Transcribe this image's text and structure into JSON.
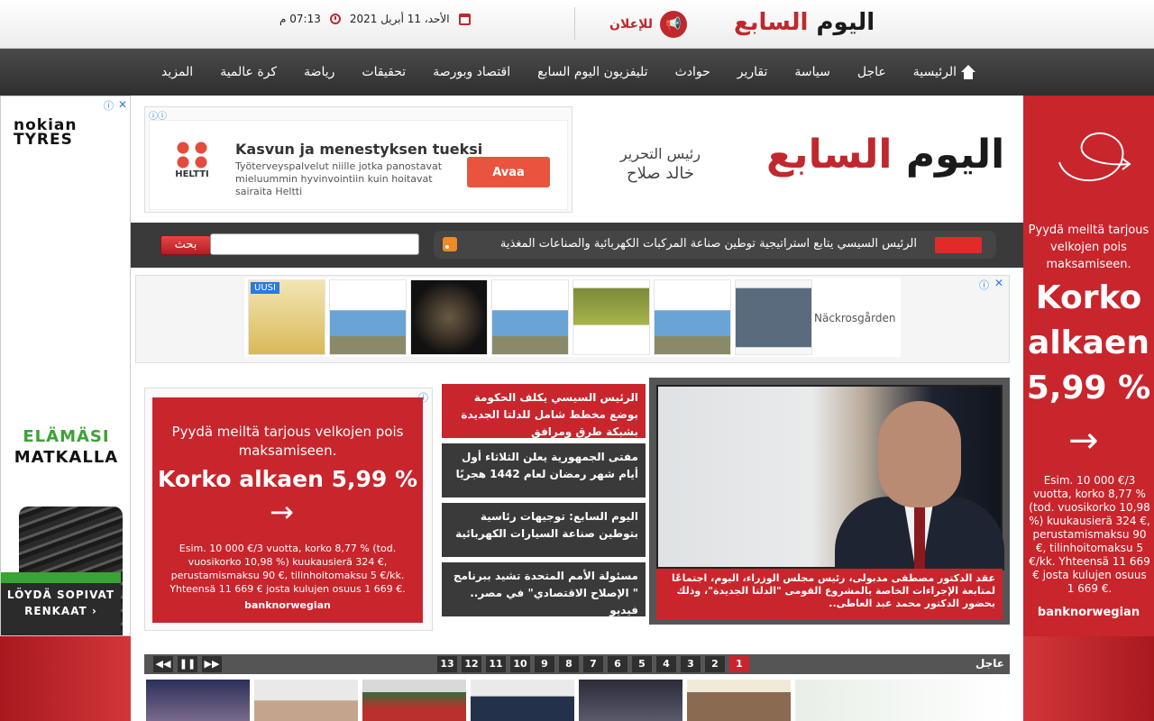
{
  "topbar": {
    "date": "الأحد، 11 أبريل 2021",
    "time": "07:13 م",
    "advertise_label": "للإعلان",
    "logo_red": "اليوم",
    "logo_dark": "السابع"
  },
  "nav": {
    "items": [
      "الرئيسية",
      "عاجل",
      "سياسة",
      "تقارير",
      "حوادث",
      "تليفزيون اليوم السابع",
      "اقتصاد وبورصة",
      "تحقيقات",
      "رياضة",
      "كرة عالمية",
      "المزيد"
    ]
  },
  "left_ad": {
    "brand": "nokian TYRES",
    "slogan_line1": "ELÄMÄSI",
    "slogan_line2": "MATKALLA",
    "cta_line1": "LÖYDÄ SOPIVAT",
    "cta_line2": "RENKAAT ›"
  },
  "right_ad": {
    "lead": "Pyydä meiltä tarjous velkojen pois maksamiseen.",
    "big_line1": "Korko",
    "big_line2": "alkaen",
    "big_line3": "5,99 %",
    "small": "Esim. 10 000 €/3 vuotta, korko 8,77 % (tod. vuosikorko 10,98 %) kuukausierä 324 €, perustamismaksu 90 €, tilinhoitomaksu 5 €/kk. Yhteensä 11 669 € josta kulujen osuus 1 669 €.",
    "bank": "banknorwegian"
  },
  "header_ad": {
    "logo_text": "HELTTI",
    "title": "Kasvun ja menestyksen tueksi",
    "text": "Työterveyspalvelut niille jotka panostavat mieluummin hyvinvointiin kuin hoitavat sairaita Heltti",
    "button": "Avaa"
  },
  "editor": {
    "label": "رئيس التحرير",
    "name": "خالد صلاح"
  },
  "search": {
    "button": "بحث",
    "placeholder": ""
  },
  "ticker": {
    "text": "الرئيس السيسي يتابع استراتيجية توطين صناعة المركبات الكهربائية والصناعات المغذية"
  },
  "strip_ad": {
    "badge": "UUSI",
    "brand": "Näckrosgården"
  },
  "mid_ad": {
    "lead": "Pyydä meiltä tarjous velkojen pois maksamiseen.",
    "big": "Korko alkaen 5,99 %",
    "small": "Esim. 10 000 €/3 vuotta, korko 8,77 % (tod. vuosikorko 10,98 %) kuukausierä 324 €, perustamismaksu 90 €, tilinhoitomaksu 5 €/kk. Yhteensä 11 669 € josta kulujen osuus 1 669 €.",
    "bank": "banknorwegian"
  },
  "news": [
    "الرئيس السيسي يكلف الحكومة بوضع مخطط شامل للدلتا الجديدة بشبكة طرق ومرافق",
    "مفتى الجمهورية يعلن الثلاثاء أول أيام شهر رمضان لعام 1442 هجريًا",
    "اليوم السابع: توجيهات رئاسية بتوطين صناعة السيارات الكهربائية",
    "مسئولة الأمم المتحدة تشيد ببرنامج \" الإصلاح الاقتصادي\" في مصر.. فيديو"
  ],
  "hero": {
    "caption": "عقد الدكتور مصطفى مدبولى، رئيس مجلس الوزراء، اليوم، اجتماعًا لمتابعة الإجراءات الخاصة بالمشروع القومى \"الدلتا الجديدة\"، وذلك بحضور الدكتور محمد عبد العاطى.."
  },
  "pager": {
    "label": "عاجل",
    "pages": [
      "1",
      "2",
      "3",
      "4",
      "5",
      "6",
      "7",
      "8",
      "9",
      "10",
      "11",
      "12",
      "13"
    ]
  },
  "colors": {
    "accent": "#c0282d",
    "nav": "#3a3a3a",
    "ad_red": "#c9252c",
    "nokian_green": "#3aa335"
  }
}
